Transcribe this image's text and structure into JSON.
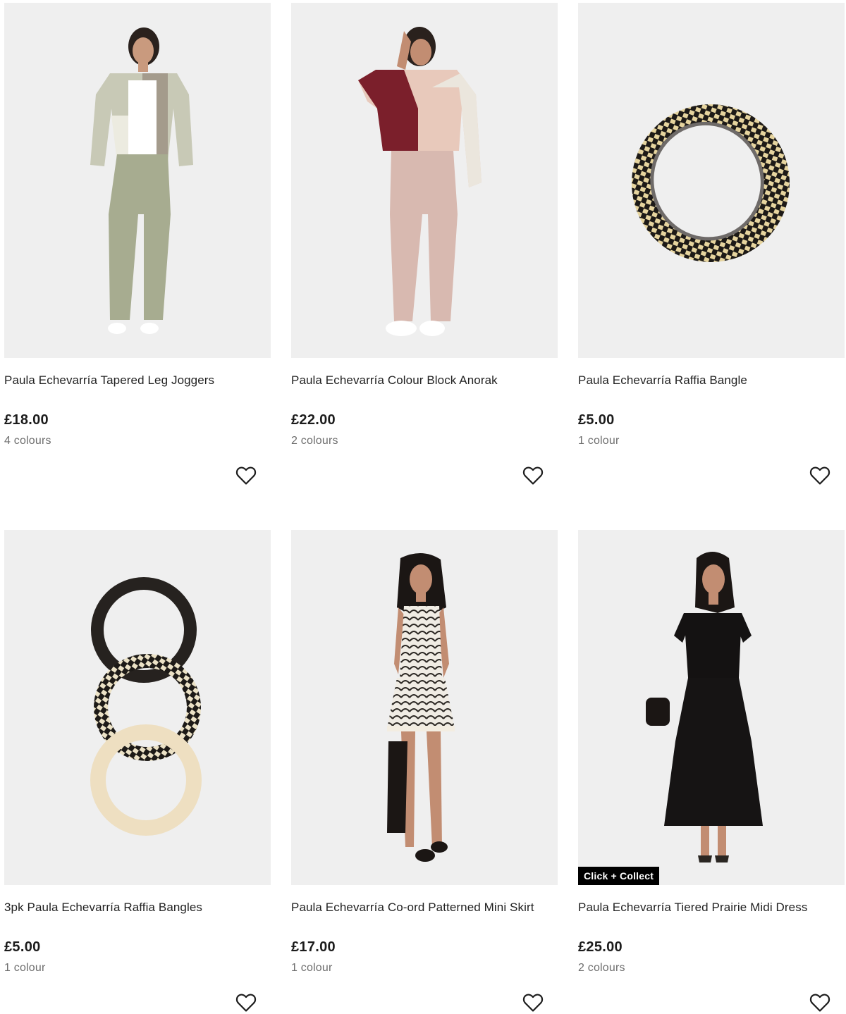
{
  "products": [
    {
      "name": "Paula Echevarría Tapered Leg Joggers",
      "price": "£18.00",
      "colours": "4 colours",
      "image": "woman-sage-jacket-joggers"
    },
    {
      "name": "Paula Echevarría Colour Block Anorak",
      "price": "£22.00",
      "colours": "2 colours",
      "image": "woman-burgundy-pink-anorak"
    },
    {
      "name": "Paula Echevarría Raffia Bangle",
      "price": "£5.00",
      "colours": "1 colour",
      "image": "black-cream-raffia-bangle"
    },
    {
      "name": "3pk Paula Echevarría Raffia Bangles",
      "price": "£5.00",
      "colours": "1 colour",
      "image": "three-raffia-bangles"
    },
    {
      "name": "Paula Echevarría Co-ord Patterned Mini Skirt",
      "price": "£17.00",
      "colours": "1 colour",
      "image": "woman-patterned-mini-skirt"
    },
    {
      "name": "Paula Echevarría Tiered Prairie Midi Dress",
      "price": "£25.00",
      "colours": "2 colours",
      "image": "woman-black-midi-dress",
      "badge": "Click + Collect"
    }
  ],
  "icons": {
    "wishlist": "heart-outline-icon"
  },
  "colors": {
    "tile_background": "#efefef",
    "badge_background": "#000000",
    "badge_text": "#ffffff",
    "secondary_text": "#6e6e6e"
  }
}
